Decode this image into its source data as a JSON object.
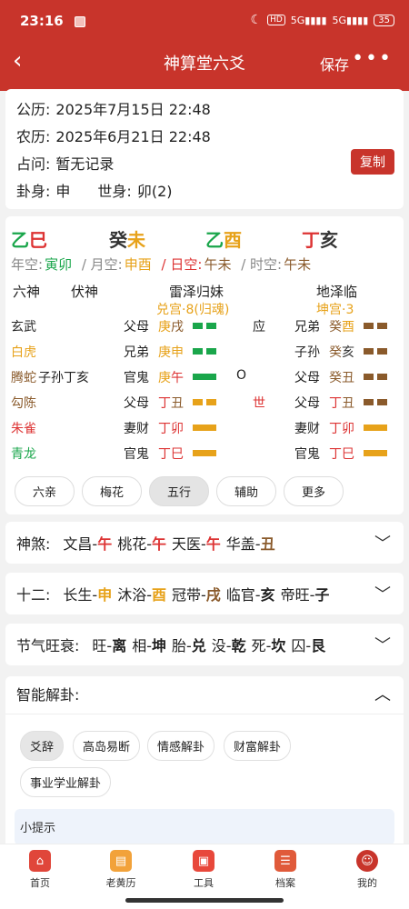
{
  "status": {
    "time": "23:16",
    "net": "5G",
    "battery": "35"
  },
  "nav": {
    "back": "‹",
    "title": "神算堂六爻",
    "save": "保存",
    "more": "•••"
  },
  "info": {
    "solar_label": "公历:",
    "solar": "2025年7月15日 22:48",
    "lunar_label": "农历:",
    "lunar": "2025年6月21日 22:48",
    "ask_label": "占问:",
    "ask": "暂无记录",
    "copy": "复制",
    "guashen_label": "卦身:",
    "guashen": "申",
    "shishen_label": "世身:",
    "shishen": "卯(2)"
  },
  "ganzhi": {
    "y1": "乙",
    "y2": "巳",
    "m1": "癸",
    "m2": "未",
    "d1": "乙",
    "d2": "酉",
    "h1": "丁",
    "h2": "亥"
  },
  "kong": {
    "nian": "年空:",
    "nian_v": "寅卯",
    "yue": "/ 月空:",
    "yue_v": "申酉",
    "ri": "/ 日空:",
    "ri_v": "午未",
    "shi": "/ 时空:",
    "shi_v": "午未"
  },
  "headers": {
    "liushen": "六神",
    "fushen": "伏神",
    "main": "雷泽归妹",
    "main_sub": "兑宫·8(归魂)",
    "bian": "地泽临",
    "bian_sub": "坤宫·3"
  },
  "lines": [
    {
      "god": "玄武",
      "fu": "",
      "rel": "父母",
      "gz1": "庚",
      "gz2": "戌",
      "yao": "yin",
      "mark": "应",
      "brel": "兄弟",
      "bgz1": "癸",
      "bgz2": "酉",
      "byao": "yin"
    },
    {
      "god": "白虎",
      "fu": "",
      "rel": "兄弟",
      "gz1": "庚",
      "gz2": "申",
      "yao": "yin",
      "mark": "",
      "brel": "子孙",
      "bgz1": "癸",
      "bgz2": "亥",
      "byao": "yin"
    },
    {
      "god": "腾蛇",
      "fu": "子孙丁亥",
      "rel": "官鬼",
      "gz1": "庚",
      "gz2": "午",
      "yao": "yang",
      "mark": "O",
      "brel": "父母",
      "bgz1": "癸",
      "bgz2": "丑",
      "byao": "yin"
    },
    {
      "god": "勾陈",
      "fu": "",
      "rel": "父母",
      "gz1": "丁",
      "gz2": "丑",
      "yao": "yin",
      "mark": "世",
      "brel": "父母",
      "bgz1": "丁",
      "bgz2": "丑",
      "byao": "yin"
    },
    {
      "god": "朱雀",
      "fu": "",
      "rel": "妻财",
      "gz1": "丁",
      "gz2": "卯",
      "yao": "yang",
      "mark": "",
      "brel": "妻财",
      "bgz1": "丁",
      "bgz2": "卯",
      "byao": "yang"
    },
    {
      "god": "青龙",
      "fu": "",
      "rel": "官鬼",
      "gz1": "丁",
      "gz2": "巳",
      "yao": "yang",
      "mark": "",
      "brel": "官鬼",
      "bgz1": "丁",
      "bgz2": "巳",
      "byao": "yang"
    }
  ],
  "tabs": [
    "六亲",
    "梅花",
    "五行",
    "辅助",
    "更多"
  ],
  "shensha": {
    "label": "神煞:",
    "items": [
      [
        "文昌-",
        "午"
      ],
      [
        "桃花-",
        "午"
      ],
      [
        "天医-",
        "午"
      ],
      [
        "华盖-",
        "丑"
      ]
    ]
  },
  "shier": {
    "label": "十二:",
    "items": [
      [
        "长生-",
        "申"
      ],
      [
        "沐浴-",
        "酉"
      ],
      [
        "冠带-",
        "戌"
      ],
      [
        "临官-",
        "亥"
      ],
      [
        "帝旺-",
        "子"
      ]
    ]
  },
  "jieqi": {
    "label": "节气旺衰:",
    "items": [
      [
        "旺-",
        "离"
      ],
      [
        "相-",
        "坤"
      ],
      [
        "胎-",
        "兑"
      ],
      [
        "没-",
        "乾"
      ],
      [
        "死-",
        "坎"
      ],
      [
        "囚-",
        "艮"
      ]
    ]
  },
  "ai": {
    "title": "智能解卦:",
    "pills": [
      "爻辞",
      "高岛易断",
      "情感解卦",
      "财富解卦",
      "事业学业解卦"
    ],
    "tip": "小提示"
  },
  "bottom": [
    "首页",
    "老黄历",
    "工具",
    "档案",
    "我的"
  ],
  "colors": {
    "primary": "#c8342b",
    "green": "#1aa64b",
    "orange": "#e7a21a",
    "brown": "#8a5a2b"
  }
}
